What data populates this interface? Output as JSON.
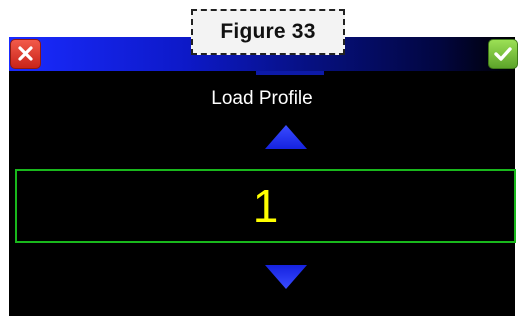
{
  "figure_label": "Figure 33",
  "dialog": {
    "prompt": "Load Profile",
    "value": "1",
    "close_icon": "close-icon",
    "confirm_icon": "checkmark-icon",
    "up_icon": "triangle-up-icon",
    "down_icon": "triangle-down-icon"
  },
  "colors": {
    "titlebar_start": "#1a2bff",
    "titlebar_end": "#000000",
    "value_border": "#19b81c",
    "value_text": "#ffff00",
    "arrow": "#1f2bff",
    "close_button": "#e0392c",
    "confirm_button": "#7cc83f"
  }
}
